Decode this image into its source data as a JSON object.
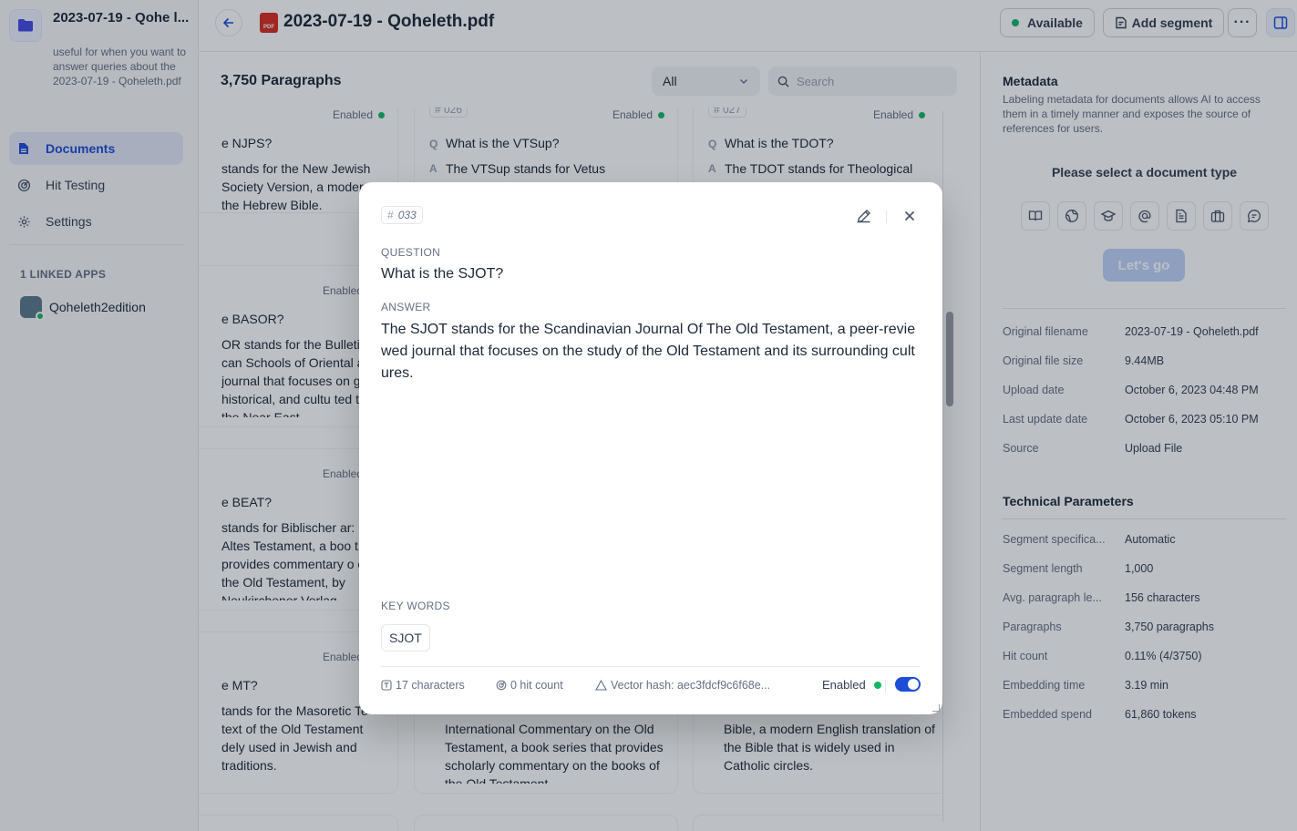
{
  "sidebar": {
    "dataset_name": "2023-07-19 - Qohe l...",
    "dataset_desc": "useful for when you want to answer queries about the 2023-07-19 - Qoheleth.pdf",
    "nav": [
      {
        "label": "Documents",
        "icon": "document-icon",
        "active": true
      },
      {
        "label": "Hit Testing",
        "icon": "target-icon",
        "active": false
      },
      {
        "label": "Settings",
        "icon": "gear-icon",
        "active": false
      }
    ],
    "linked_title": "1 LINKED APPS",
    "linked_app": "Qoheleth2edition"
  },
  "header": {
    "doc_title": "2023-07-19 - Qoheleth.pdf",
    "pdf_badge": "PDF",
    "status": "Available",
    "add_segment": "Add segment",
    "more": "···"
  },
  "list": {
    "count": "3,750 Paragraphs",
    "filter": "All",
    "search_placeholder": "Search",
    "enabled": "Enabled",
    "q_marker": "Q",
    "a_marker": "A",
    "cards": [
      {
        "idx": "# 026",
        "q": "What is the VTSup?",
        "a": "The VTSup stands for Vetus Testamentum Supplements, a book"
      },
      {
        "idx": "# 027",
        "q": "What is the TDOT?",
        "a": "The TDOT stands for Theological Dictionary of the Old Testament, a"
      },
      {
        "q": "e NJPS?",
        "a": "stands for the New Jewish Society Version, a modern of the Hebrew Bible."
      },
      {
        "q": "e BASOR?",
        "a": "OR stands for the Bulletin of can Schools of Oriental a journal that focuses on gical, historical, and cultu ted to the Near East"
      },
      {
        "q": "e BEAT?",
        "a": "stands for Biblischer ar: Altes Testament, a boo t provides commentary o of the Old Testament, by Neukirchener Verlag"
      },
      {
        "q": "e MT?",
        "a": "tands for the Masoretic Te text of the Old Testament dely used in Jewish and traditions."
      },
      {
        "a": "International Commentary on the Old Testament, a book series that provides scholarly commentary on the books of the Old Testament"
      },
      {
        "a": "Bible, a modern English translation of the Bible that is widely used in Catholic circles."
      }
    ]
  },
  "modal": {
    "index": "033",
    "question_label": "QUESTION",
    "question": "What is the SJOT?",
    "answer_label": "ANSWER",
    "answer": "The SJOT stands for the Scandinavian Journal Of The Old Testament, a peer-reviewed journal that focuses on the study of the Old Testament and its surrounding cultures.",
    "keywords_label": "KEY WORDS",
    "keywords": [
      "SJOT"
    ],
    "characters": "17 characters",
    "hit_count": "0 hit count",
    "vector_hash": "Vector hash: aec3fdcf9c6f68e...",
    "enabled_label": "Enabled",
    "enabled": true
  },
  "metadata": {
    "title": "Metadata",
    "description": "Labeling metadata for documents allows AI to access them in a timely manner and exposes the source of references for users.",
    "select_type": "Please select a document type",
    "type_icons": [
      "book-icon",
      "globe-icon",
      "graduation-cap-icon",
      "at-sign-icon",
      "file-text-icon",
      "briefcase-icon",
      "chat-icon"
    ],
    "go_button": "Let's go",
    "info": [
      {
        "k": "Original filename",
        "v": "2023-07-19 - Qoheleth.pdf"
      },
      {
        "k": "Original file size",
        "v": "9.44MB"
      },
      {
        "k": "Upload date",
        "v": "October 6, 2023 04:48 PM"
      },
      {
        "k": "Last update date",
        "v": "October 6, 2023 05:10 PM"
      },
      {
        "k": "Source",
        "v": "Upload File"
      }
    ],
    "tech_title": "Technical Parameters",
    "tech": [
      {
        "k": "Segment specifica...",
        "v": "Automatic"
      },
      {
        "k": "Segment length",
        "v": "1,000"
      },
      {
        "k": "Avg. paragraph le...",
        "v": "156 characters"
      },
      {
        "k": "Paragraphs",
        "v": "3,750 paragraphs"
      },
      {
        "k": "Hit count",
        "v": "0.11% (4/3750)"
      },
      {
        "k": "Embedding time",
        "v": "3.19 min"
      },
      {
        "k": "Embedded spend",
        "v": "61,860 tokens"
      }
    ]
  },
  "colors": {
    "accent": "#1d4ed8",
    "success": "#12b76a",
    "pdf": "#d92d20"
  }
}
